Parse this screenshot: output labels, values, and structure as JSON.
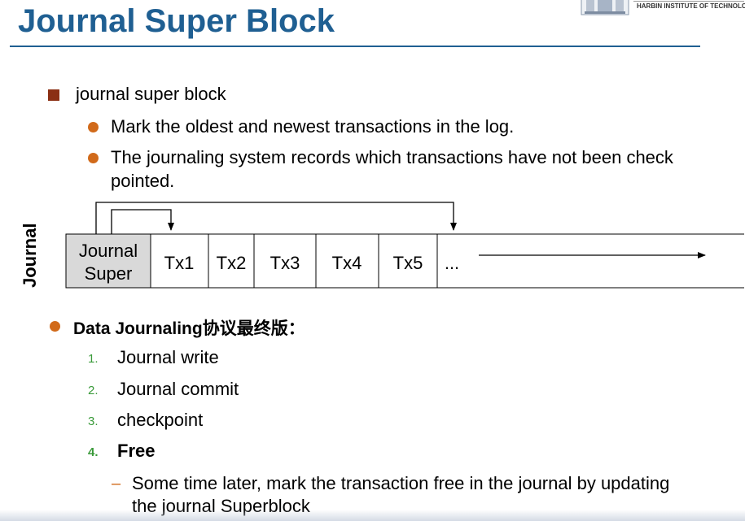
{
  "slide": {
    "title": "Journal Super Block",
    "logo_text": "HARBIN INSTITUTE OF TECHNOLOGY",
    "bullet_main": "journal super block",
    "sub_bullets": [
      "Mark the oldest and newest transactions in the log.",
      "The journaling system records which transactions have not been check",
      "pointed."
    ],
    "diagram": {
      "side_label": "Journal",
      "cells": [
        {
          "label_line1": "Journal",
          "label_line2": "Super"
        },
        {
          "label": "Tx1"
        },
        {
          "label": "Tx2"
        },
        {
          "label": "Tx3"
        },
        {
          "label": "Tx4"
        },
        {
          "label": "Tx5"
        },
        {
          "label": "..."
        }
      ],
      "colors": {
        "super_fill": "#d9d9d9",
        "border": "#000000"
      }
    },
    "protocol_heading": "Data Journaling协议最终版：",
    "steps": [
      {
        "num": "1.",
        "text": "Journal write"
      },
      {
        "num": "2.",
        "text": "Journal commit"
      },
      {
        "num": "3.",
        "text": "checkpoint"
      },
      {
        "num": "4.",
        "text": "Free"
      }
    ],
    "free_note_line1": "Some time later, mark the transaction free in the journal by updating",
    "free_note_line2": "the journal Superblock",
    "colors": {
      "title": "#1f5f92",
      "square_bullet": "#8b2f14",
      "dot_bullet": "#d16a1a",
      "step_number": "#3a9a3a"
    }
  }
}
